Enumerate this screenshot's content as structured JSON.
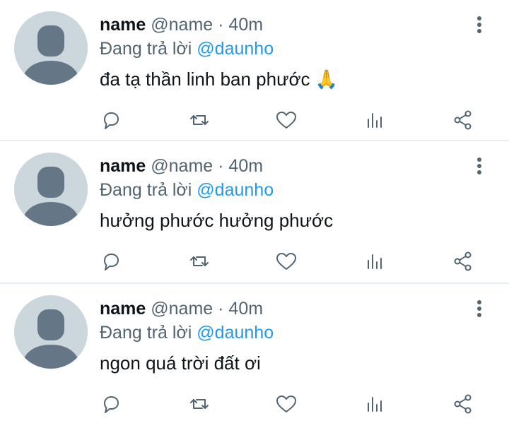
{
  "tweets": [
    {
      "display_name": "name",
      "handle": "@name",
      "separator": "·",
      "time": "40m",
      "reply_prefix": "Đang trả lời",
      "reply_to": "@daunho",
      "text": "đa tạ thần linh ban phước 🙏"
    },
    {
      "display_name": "name",
      "handle": "@name",
      "separator": "·",
      "time": "40m",
      "reply_prefix": "Đang trả lời",
      "reply_to": "@daunho",
      "text": "hưởng phước hưởng phước"
    },
    {
      "display_name": "name",
      "handle": "@name",
      "separator": "·",
      "time": "40m",
      "reply_prefix": "Đang trả lời",
      "reply_to": "@daunho",
      "text": "ngon quá trời đất ơi"
    }
  ],
  "icons": {
    "avatar": "default-avatar-icon",
    "more": "more-vertical-icon",
    "reply": "reply-bubble-icon",
    "retweet": "retweet-icon",
    "like": "heart-icon",
    "analytics": "analytics-bars-icon",
    "share": "share-icon"
  },
  "colors": {
    "text": "#0f1419",
    "secondary": "#536471",
    "link": "#1d9bf0",
    "avatar_bg": "#ccd6dd",
    "avatar_fg": "#657786",
    "divider": "#e6ecf0"
  }
}
